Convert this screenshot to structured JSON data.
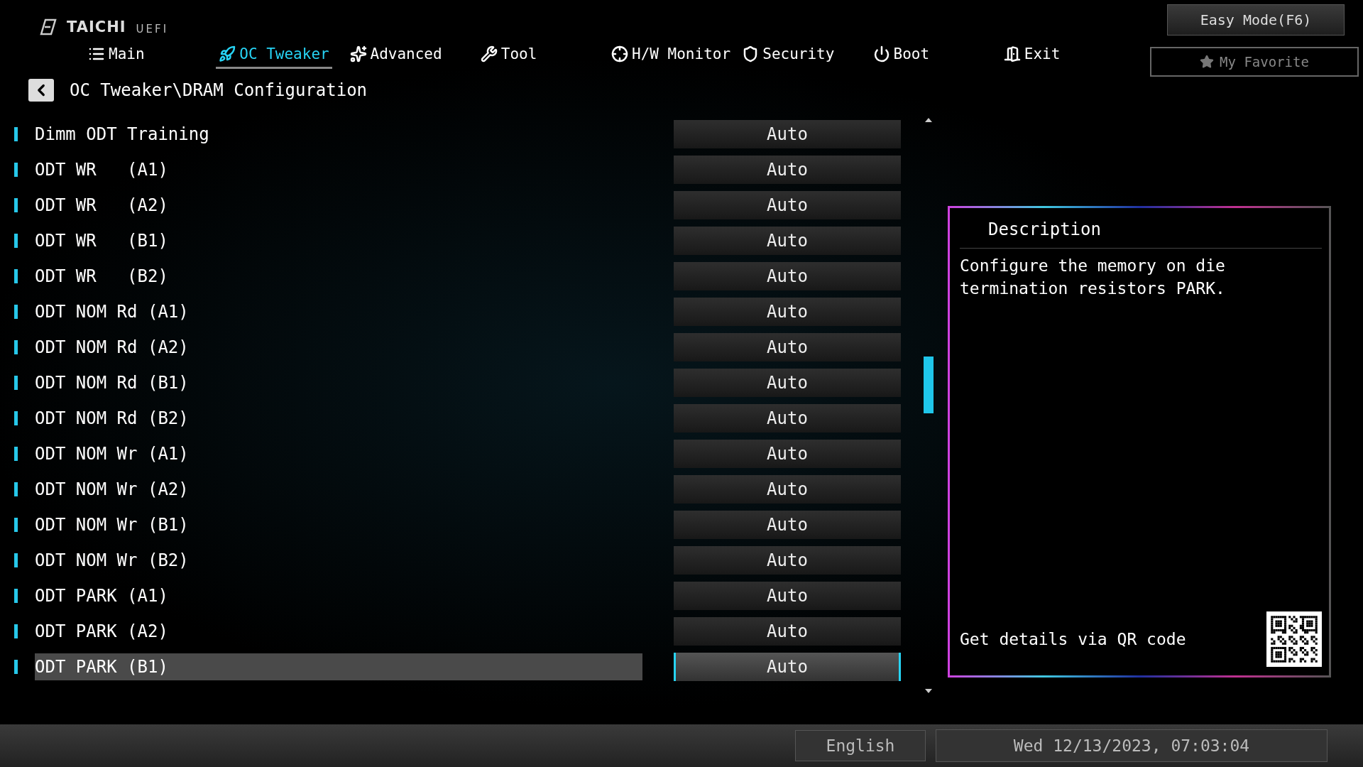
{
  "brand": {
    "logo": "TAICHI",
    "suffix": "UEFI"
  },
  "easy_mode_button": "Easy Mode(F6)",
  "my_favorite_button": "My Favorite",
  "tabs": [
    {
      "label": "Main",
      "kind": "list",
      "selected": false
    },
    {
      "label": "OC Tweaker",
      "kind": "rocket",
      "selected": true
    },
    {
      "label": "Advanced",
      "kind": "star",
      "selected": false
    },
    {
      "label": "Tool",
      "kind": "tools",
      "selected": false
    },
    {
      "label": "H/W Monitor",
      "kind": "crosshair",
      "selected": false
    },
    {
      "label": "Security",
      "kind": "shield",
      "selected": false
    },
    {
      "label": "Boot",
      "kind": "power",
      "selected": false
    },
    {
      "label": "Exit",
      "kind": "door",
      "selected": false
    }
  ],
  "breadcrumb": "OC Tweaker\\DRAM Configuration",
  "settings": [
    {
      "label": "Dimm ODT Training",
      "value": "Auto",
      "selected": false
    },
    {
      "label": "ODT WR   (A1)",
      "value": "Auto",
      "selected": false
    },
    {
      "label": "ODT WR   (A2)",
      "value": "Auto",
      "selected": false
    },
    {
      "label": "ODT WR   (B1)",
      "value": "Auto",
      "selected": false
    },
    {
      "label": "ODT WR   (B2)",
      "value": "Auto",
      "selected": false
    },
    {
      "label": "ODT NOM Rd (A1)",
      "value": "Auto",
      "selected": false
    },
    {
      "label": "ODT NOM Rd (A2)",
      "value": "Auto",
      "selected": false
    },
    {
      "label": "ODT NOM Rd (B1)",
      "value": "Auto",
      "selected": false
    },
    {
      "label": "ODT NOM Rd (B2)",
      "value": "Auto",
      "selected": false
    },
    {
      "label": "ODT NOM Wr (A1)",
      "value": "Auto",
      "selected": false
    },
    {
      "label": "ODT NOM Wr (A2)",
      "value": "Auto",
      "selected": false
    },
    {
      "label": "ODT NOM Wr (B1)",
      "value": "Auto",
      "selected": false
    },
    {
      "label": "ODT NOM Wr (B2)",
      "value": "Auto",
      "selected": false
    },
    {
      "label": "ODT PARK (A1)",
      "value": "Auto",
      "selected": false
    },
    {
      "label": "ODT PARK (A2)",
      "value": "Auto",
      "selected": false
    },
    {
      "label": "ODT PARK (B1)",
      "value": "Auto",
      "selected": true
    }
  ],
  "description": {
    "title": "Description",
    "text": "Configure the memory on die termination resistors PARK.",
    "qr_caption": "Get details via QR code"
  },
  "status_bar": {
    "language": "English",
    "datetime": "Wed 12/13/2023, 07:03:04"
  }
}
